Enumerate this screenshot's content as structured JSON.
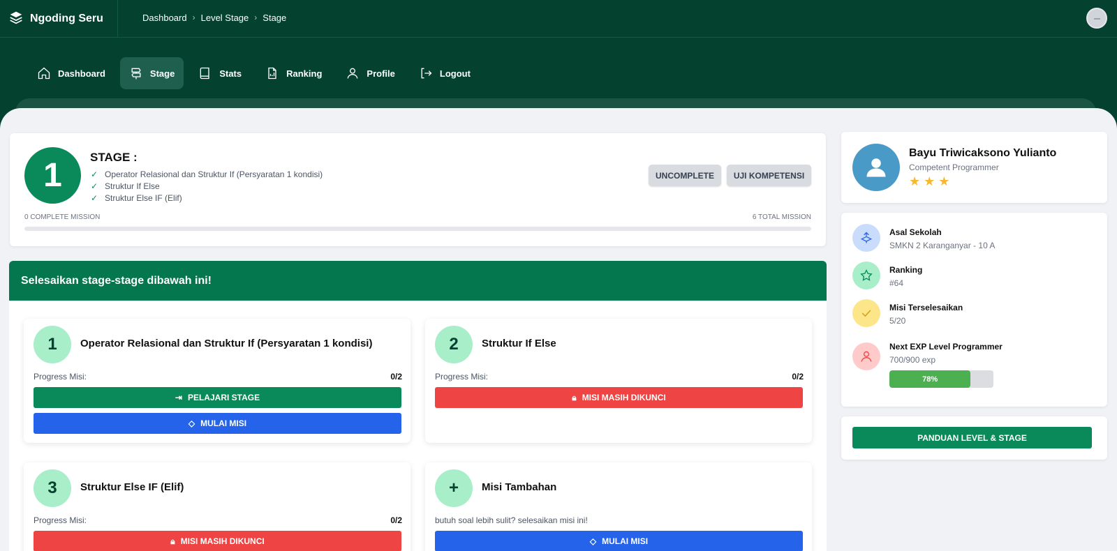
{
  "app": {
    "name": "Ngoding Seru"
  },
  "breadcrumb": [
    "Dashboard",
    "Level Stage",
    "Stage"
  ],
  "nav": [
    {
      "label": "Dashboard",
      "icon": "home-icon",
      "active": false
    },
    {
      "label": "Stage",
      "icon": "signpost-icon",
      "active": true
    },
    {
      "label": "Stats",
      "icon": "book-icon",
      "active": false
    },
    {
      "label": "Ranking",
      "icon": "ranking-icon",
      "active": false
    },
    {
      "label": "Profile",
      "icon": "user-icon",
      "active": false
    },
    {
      "label": "Logout",
      "icon": "logout-icon",
      "active": false
    }
  ],
  "stage": {
    "number": "1",
    "title": "STAGE :",
    "topics": [
      "Operator Relasional dan Struktur If (Persyaratan 1 kondisi)",
      "Struktur If Else",
      "Struktur Else IF (Elif)"
    ],
    "btn_uncomplete": "UNCOMPLETE",
    "btn_uji": "UJI KOMPETENSI",
    "complete_mission": "0 COMPLETE MISSION",
    "total_mission": "6 TOTAL MISSION",
    "progress": 0
  },
  "missions_panel": {
    "header": "Selesaikan stage-stage dibawah ini!",
    "progress_label": "Progress Misi:",
    "cards": [
      {
        "num": "1",
        "title": "Operator Relasional dan Struktur If (Persyaratan 1 kondisi)",
        "progress": "0/2",
        "btn1": "PELAJARI STAGE",
        "btn2": "MULAI MISI"
      },
      {
        "num": "2",
        "title": "Struktur If Else",
        "progress": "0/2",
        "btn1": "MISI MASIH DIKUNCI"
      },
      {
        "num": "3",
        "title": "Struktur Else IF (Elif)",
        "progress": "0/2",
        "btn1": "MISI MASIH DIKUNCI"
      },
      {
        "num": "+",
        "title": "Misi Tambahan",
        "desc": "butuh soal lebih sulit? selesaikan misi ini!",
        "btn1": "MULAI MISI"
      }
    ]
  },
  "profile": {
    "name": "Bayu Triwicaksono Yulianto",
    "role": "Competent Programmer",
    "stars": 3,
    "stars_text": "★★★"
  },
  "info": {
    "school_label": "Asal Sekolah",
    "school_value": "SMKN 2 Karanganyar - 10 A",
    "ranking_label": "Ranking",
    "ranking_value": "#64",
    "missions_label": "Misi Terselesaikan",
    "missions_value": "5/20",
    "exp_label": "Next EXP Level Programmer",
    "exp_value": "700/900 exp",
    "exp_percent": "78%",
    "exp_fraction": 0.78
  },
  "guide_button": "PANDUAN LEVEL & STAGE",
  "colors": {
    "header_bg": "#05412f",
    "primary_green": "#0a8a5a",
    "blue": "#2563eb",
    "red": "#ef4444",
    "star": "#f5b82e"
  }
}
